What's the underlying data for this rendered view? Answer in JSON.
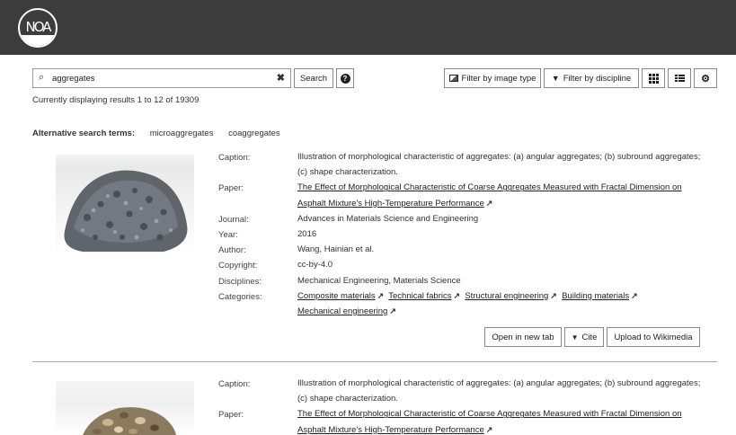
{
  "header": {
    "logo_text": "NOA"
  },
  "search": {
    "value": "aggregates",
    "placeholder": "",
    "search_label": "Search",
    "help_label": "?"
  },
  "toolbar": {
    "filter_image_type": "Filter by image type",
    "filter_discipline": "Filter by discipline"
  },
  "results_count": "Currently displaying results 1 to 12 of 19309",
  "alternative": {
    "label": "Alternative search terms:",
    "terms": [
      "microaggregates",
      "coaggregates"
    ]
  },
  "labels": {
    "caption": "Caption:",
    "paper": "Paper:",
    "journal": "Journal:",
    "year": "Year:",
    "author": "Author:",
    "copyright": "Copyright:",
    "disciplines": "Disciplines:",
    "categories": "Categories:"
  },
  "results": [
    {
      "caption_1": "Illustration of morphological characteristic of aggregates: (a) angular aggregates; (b) subround aggregates;",
      "caption_2": "(c) shape characterization.",
      "paper_1": "The Effect of Morphological Characteristic of Coarse Aggregates Measured with Fractal Dimension on",
      "paper_2": "Asphalt Mixture's High-Temperature Performance",
      "journal": "Advances in Materials Science and Engineering",
      "year": "2016",
      "author": "Wang, Hainian et al.",
      "copyright": "cc-by-4.0",
      "disciplines": "Mechanical Engineering, Materials Science",
      "categories": [
        "Composite materials",
        "Technical fabrics",
        "Structural engineering",
        "Building materials",
        "Mechanical engineering"
      ],
      "actions": {
        "open": "Open in new tab",
        "cite": "Cite",
        "upload": "Upload to Wikimedia"
      }
    },
    {
      "caption_1": "Illustration of morphological characteristic of aggregates: (a) angular aggregates; (b) subround aggregates;",
      "caption_2": "(c) shape characterization.",
      "paper_1": "The Effect of Morphological Characteristic of Coarse Aggregates Measured with Fractal Dimension on",
      "paper_2": "Asphalt Mixture's High-Temperature Performance"
    }
  ],
  "colors": {
    "topbar": "#3c3c3c",
    "background": "#ffffff",
    "border": "#888888"
  }
}
